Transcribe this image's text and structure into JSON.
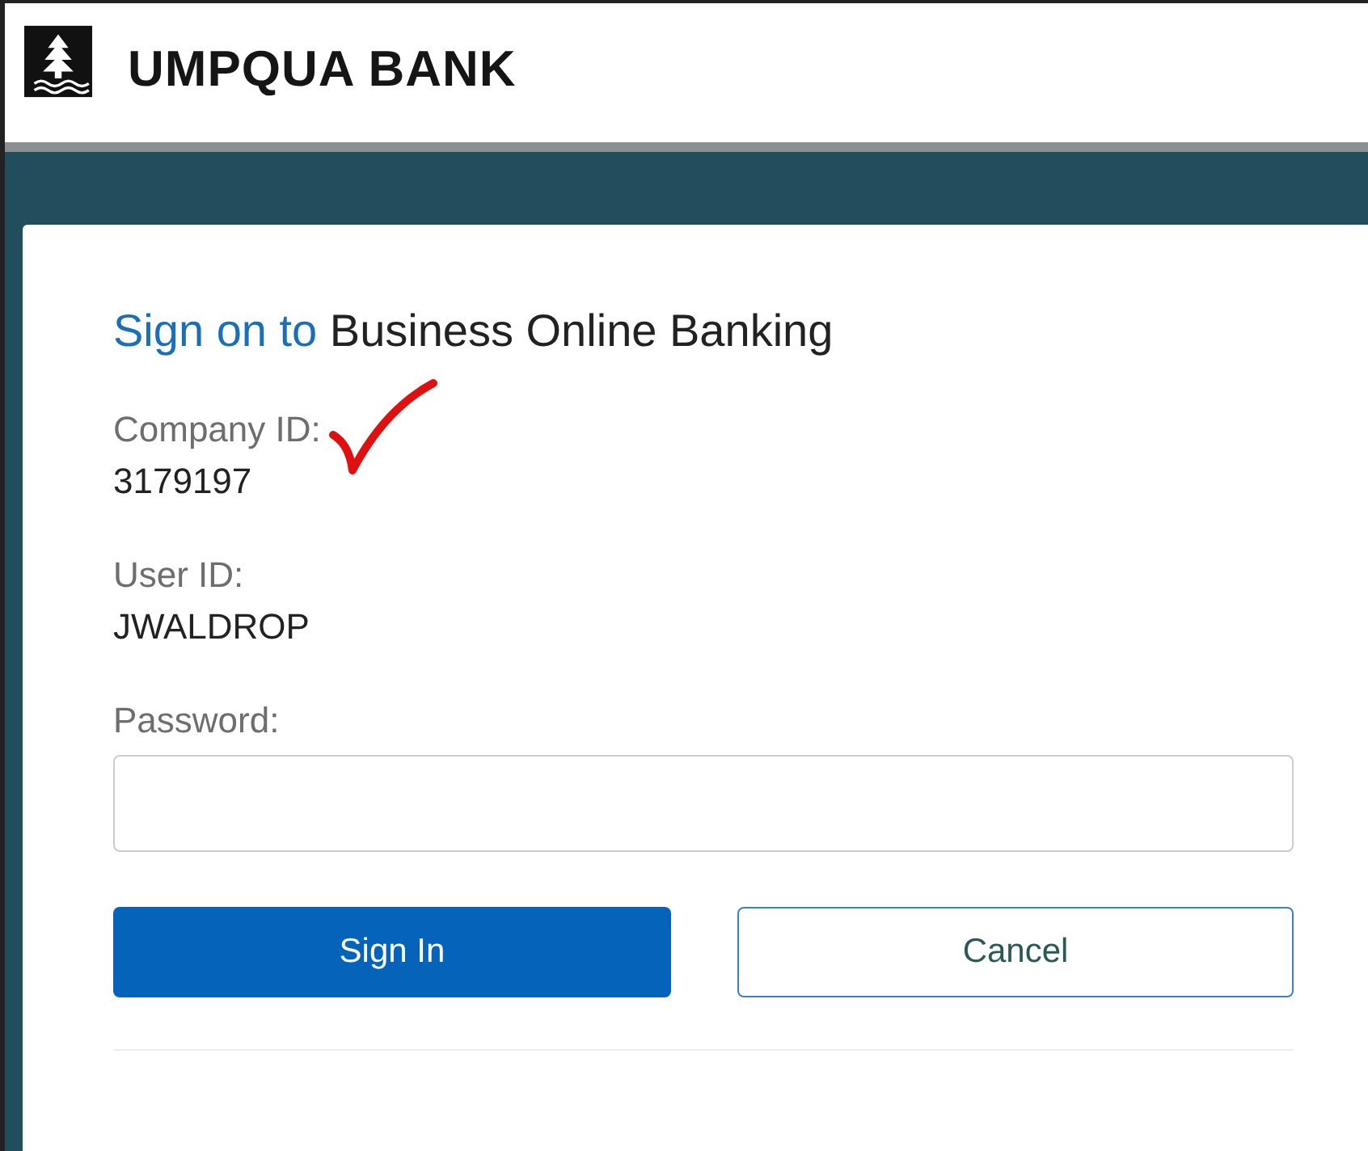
{
  "brand": {
    "name": "UMPQUA BANK"
  },
  "form": {
    "title": {
      "prefix": "Sign on to",
      "rest": "Business Online Banking"
    },
    "fields": [
      {
        "kind": "readonly",
        "label": "Company ID:",
        "value": "3179197",
        "checked": true
      },
      {
        "kind": "readonly",
        "label": "User ID:",
        "value": "JWALDROP",
        "checked": false
      },
      {
        "kind": "input",
        "label": "Password:"
      }
    ],
    "buttons": [
      {
        "kind": "primary",
        "label": "Sign In"
      },
      {
        "kind": "secondary",
        "label": "Cancel"
      }
    ]
  }
}
